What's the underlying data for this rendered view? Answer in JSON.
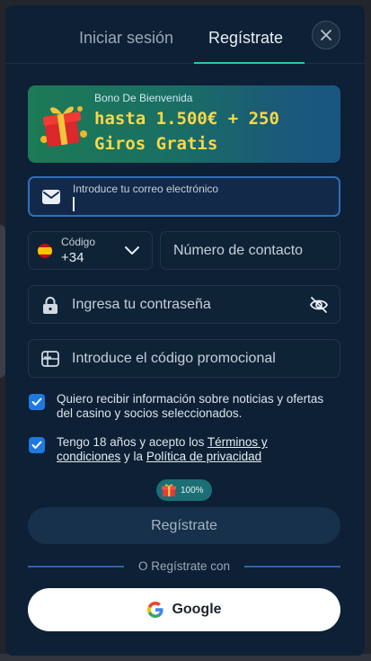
{
  "tabs": {
    "login_label": "Iniciar sesión",
    "register_label": "Regístrate",
    "active": "register"
  },
  "banner": {
    "label": "Bono De Bienvenida",
    "title": "hasta 1.500€ + 250 Giros Gratis",
    "icon": "gift-box-icon"
  },
  "form": {
    "email": {
      "label": "Introduce tu correo electrónico",
      "value": "",
      "icon": "envelope-icon"
    },
    "country_code": {
      "label": "Código",
      "value": "+34",
      "flag": "spain-flag-icon"
    },
    "phone": {
      "placeholder": "Número de contacto"
    },
    "password": {
      "placeholder": "Ingresa tu contraseña",
      "icon": "lock-icon",
      "toggle_icon": "eye-off-icon"
    },
    "promo": {
      "placeholder": "Introduce el código promocional",
      "icon": "promo-card-icon"
    }
  },
  "consents": {
    "news": {
      "checked": true,
      "text": "Quiero recibir información sobre noticias y ofertas del casino y socios seleccionados."
    },
    "terms": {
      "checked": true,
      "prefix": "Tengo 18 años y acepto los ",
      "terms_link": "Términos y condiciones",
      "middle": " y la ",
      "privacy_link": "Política de privacidad"
    }
  },
  "progress": {
    "value": "100%"
  },
  "buttons": {
    "register": "Regístrate",
    "divider_text": "O Regístrate con",
    "google": "Google"
  },
  "colors": {
    "modal_bg": "#0d2035",
    "accent_tab": "#2ec5a3",
    "checkbox": "#1f78e0",
    "banner_text": "#f6d84a"
  }
}
